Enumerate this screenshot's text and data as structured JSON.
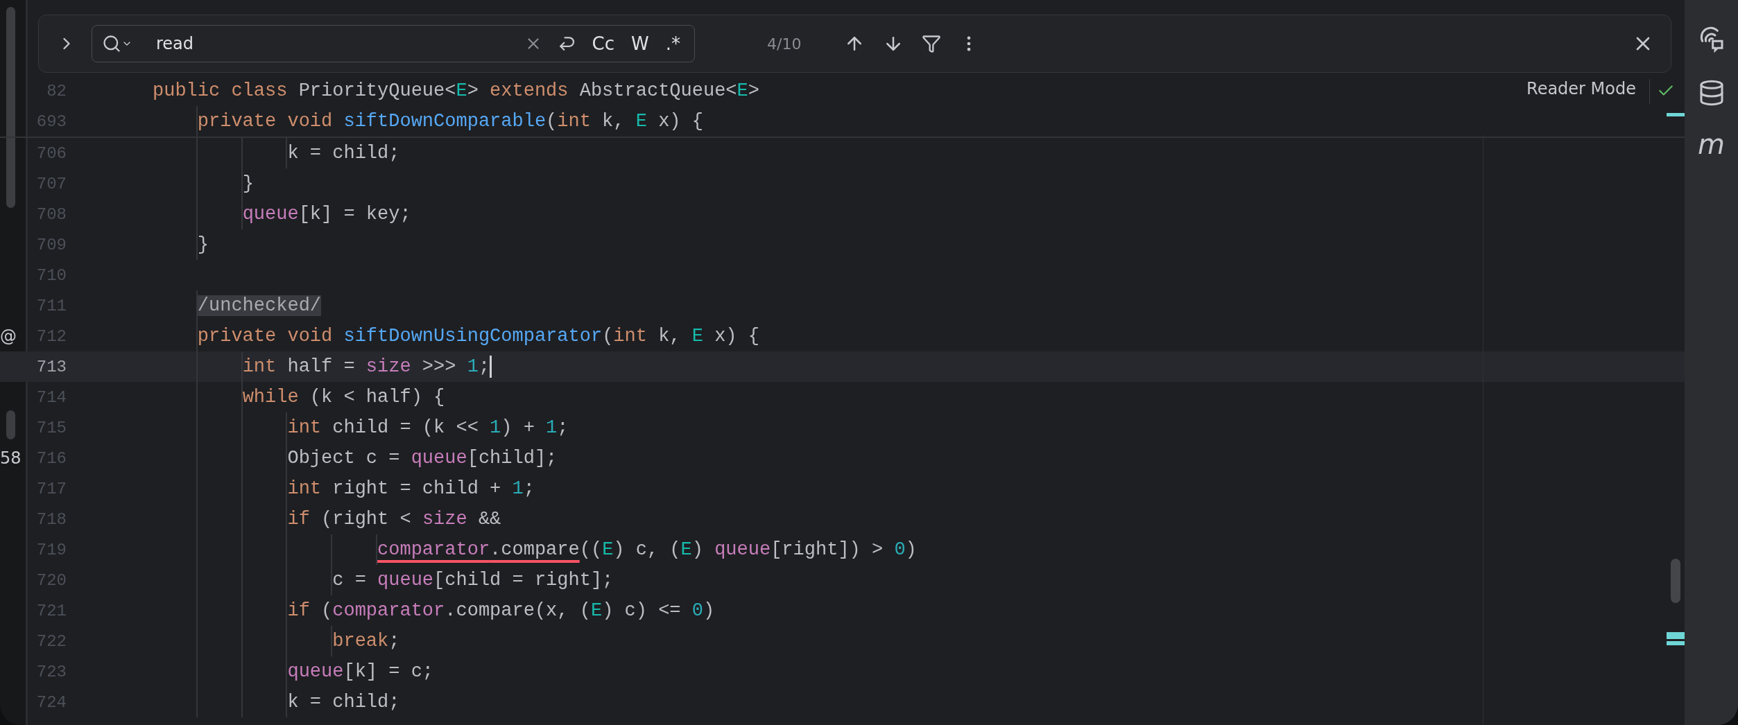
{
  "find_bar": {
    "query": "read",
    "options": [
      "Cc",
      "W",
      ".*"
    ],
    "match_count": "4/10"
  },
  "reader_mode": {
    "label": "Reader Mode"
  },
  "sticky_lines": [
    {
      "number": "82",
      "tokens": [
        {
          "kind": "keyword",
          "text": "public class"
        },
        {
          "kind": "plain",
          "text": " PriorityQueue<"
        },
        {
          "kind": "type",
          "text": "E"
        },
        {
          "kind": "plain",
          "text": "> "
        },
        {
          "kind": "keyword",
          "text": "extends"
        },
        {
          "kind": "plain",
          "text": " AbstractQueue<"
        },
        {
          "kind": "type",
          "text": "E"
        },
        {
          "kind": "plain",
          "text": ">"
        }
      ]
    },
    {
      "number": "693",
      "tokens": [
        {
          "kind": "keyword",
          "text": "    private void "
        },
        {
          "kind": "method",
          "text": "siftDownComparable"
        },
        {
          "kind": "plain",
          "text": "("
        },
        {
          "kind": "keyword",
          "text": "int"
        },
        {
          "kind": "plain",
          "text": " k, "
        },
        {
          "kind": "type",
          "text": "E"
        },
        {
          "kind": "plain",
          "text": " x) {"
        }
      ]
    }
  ],
  "lines": [
    {
      "number": "706",
      "current": false,
      "tokens": [
        {
          "kind": "plain",
          "text": "            k = child;"
        }
      ]
    },
    {
      "number": "707",
      "current": false,
      "tokens": [
        {
          "kind": "plain",
          "text": "        }"
        }
      ]
    },
    {
      "number": "708",
      "current": false,
      "tokens": [
        {
          "kind": "field",
          "text": "        queue"
        },
        {
          "kind": "plain",
          "text": "[k] = key;"
        }
      ]
    },
    {
      "number": "709",
      "current": false,
      "tokens": [
        {
          "kind": "plain",
          "text": "    }"
        }
      ]
    },
    {
      "number": "710",
      "current": false
    },
    {
      "number": "711",
      "current": false,
      "tokens": [
        {
          "kind": "folded",
          "text": "    /unchecked/"
        }
      ]
    },
    {
      "number": "712",
      "current": false,
      "edge_label": "@",
      "tokens": [
        {
          "kind": "keyword",
          "text": "    private void "
        },
        {
          "kind": "method",
          "text": "siftDownUsingComparator"
        },
        {
          "kind": "plain",
          "text": "("
        },
        {
          "kind": "keyword",
          "text": "int"
        },
        {
          "kind": "plain",
          "text": " k, "
        },
        {
          "kind": "type",
          "text": "E"
        },
        {
          "kind": "plain",
          "text": " x) {"
        }
      ]
    },
    {
      "number": "713",
      "current": true,
      "tokens": [
        {
          "kind": "keyword",
          "text": "        int"
        },
        {
          "kind": "plain",
          "text": " half = "
        },
        {
          "kind": "field",
          "text": "size"
        },
        {
          "kind": "plain",
          "text": " >>> "
        },
        {
          "kind": "number",
          "text": "1"
        },
        {
          "kind": "plain",
          "text": ";"
        }
      ]
    },
    {
      "number": "714",
      "current": false,
      "tokens": [
        {
          "kind": "keyword",
          "text": "        while"
        },
        {
          "kind": "plain",
          "text": " (k < half) {"
        }
      ]
    },
    {
      "number": "715",
      "current": false,
      "tokens": [
        {
          "kind": "keyword",
          "text": "            int"
        },
        {
          "kind": "plain",
          "text": " child = (k << "
        },
        {
          "kind": "number",
          "text": "1"
        },
        {
          "kind": "plain",
          "text": ") + "
        },
        {
          "kind": "number",
          "text": "1"
        },
        {
          "kind": "plain",
          "text": ";"
        }
      ]
    },
    {
      "number": "716",
      "current": false,
      "edge_label": "58",
      "tokens": [
        {
          "kind": "plain",
          "text": "            Object c = "
        },
        {
          "kind": "field",
          "text": "queue"
        },
        {
          "kind": "plain",
          "text": "[child];"
        }
      ]
    },
    {
      "number": "717",
      "current": false,
      "tokens": [
        {
          "kind": "keyword",
          "text": "            int"
        },
        {
          "kind": "plain",
          "text": " right = child + "
        },
        {
          "kind": "number",
          "text": "1"
        },
        {
          "kind": "plain",
          "text": ";"
        }
      ]
    },
    {
      "number": "718",
      "current": false,
      "tokens": [
        {
          "kind": "keyword",
          "text": "            if"
        },
        {
          "kind": "plain",
          "text": " (right < "
        },
        {
          "kind": "field",
          "text": "size"
        },
        {
          "kind": "plain",
          "text": " &&"
        }
      ]
    },
    {
      "number": "719",
      "current": false,
      "tokens": [
        {
          "kind": "field",
          "text": "                    comparator",
          "error": true
        },
        {
          "kind": "plain",
          "text": ".compare",
          "error": true
        },
        {
          "kind": "plain",
          "text": "(("
        },
        {
          "kind": "type",
          "text": "E"
        },
        {
          "kind": "plain",
          "text": ") c, ("
        },
        {
          "kind": "type",
          "text": "E"
        },
        {
          "kind": "plain",
          "text": ") "
        },
        {
          "kind": "field",
          "text": "queue"
        },
        {
          "kind": "plain",
          "text": "[right]) > "
        },
        {
          "kind": "number",
          "text": "0"
        },
        {
          "kind": "plain",
          "text": ")"
        }
      ]
    },
    {
      "number": "720",
      "current": false,
      "tokens": [
        {
          "kind": "plain",
          "text": "                c = "
        },
        {
          "kind": "field",
          "text": "queue"
        },
        {
          "kind": "plain",
          "text": "[child = right];"
        }
      ]
    },
    {
      "number": "721",
      "current": false,
      "tokens": [
        {
          "kind": "keyword",
          "text": "            if"
        },
        {
          "kind": "plain",
          "text": " ("
        },
        {
          "kind": "field",
          "text": "comparator"
        },
        {
          "kind": "plain",
          "text": ".compare(x, ("
        },
        {
          "kind": "type",
          "text": "E"
        },
        {
          "kind": "plain",
          "text": ") c) <= "
        },
        {
          "kind": "number",
          "text": "0"
        },
        {
          "kind": "plain",
          "text": ")"
        }
      ]
    },
    {
      "number": "722",
      "current": false,
      "tokens": [
        {
          "kind": "keyword",
          "text": "                break"
        },
        {
          "kind": "plain",
          "text": ";"
        }
      ]
    },
    {
      "number": "723",
      "current": false,
      "tokens": [
        {
          "kind": "field",
          "text": "            queue"
        },
        {
          "kind": "plain",
          "text": "[k] = c;"
        }
      ]
    },
    {
      "number": "724",
      "current": false,
      "tokens": [
        {
          "kind": "plain",
          "text": "            k = child;"
        }
      ]
    }
  ],
  "side_tools": [
    {
      "kind": "ai-chat"
    },
    {
      "kind": "database"
    },
    {
      "kind": "text",
      "text": "m"
    }
  ]
}
